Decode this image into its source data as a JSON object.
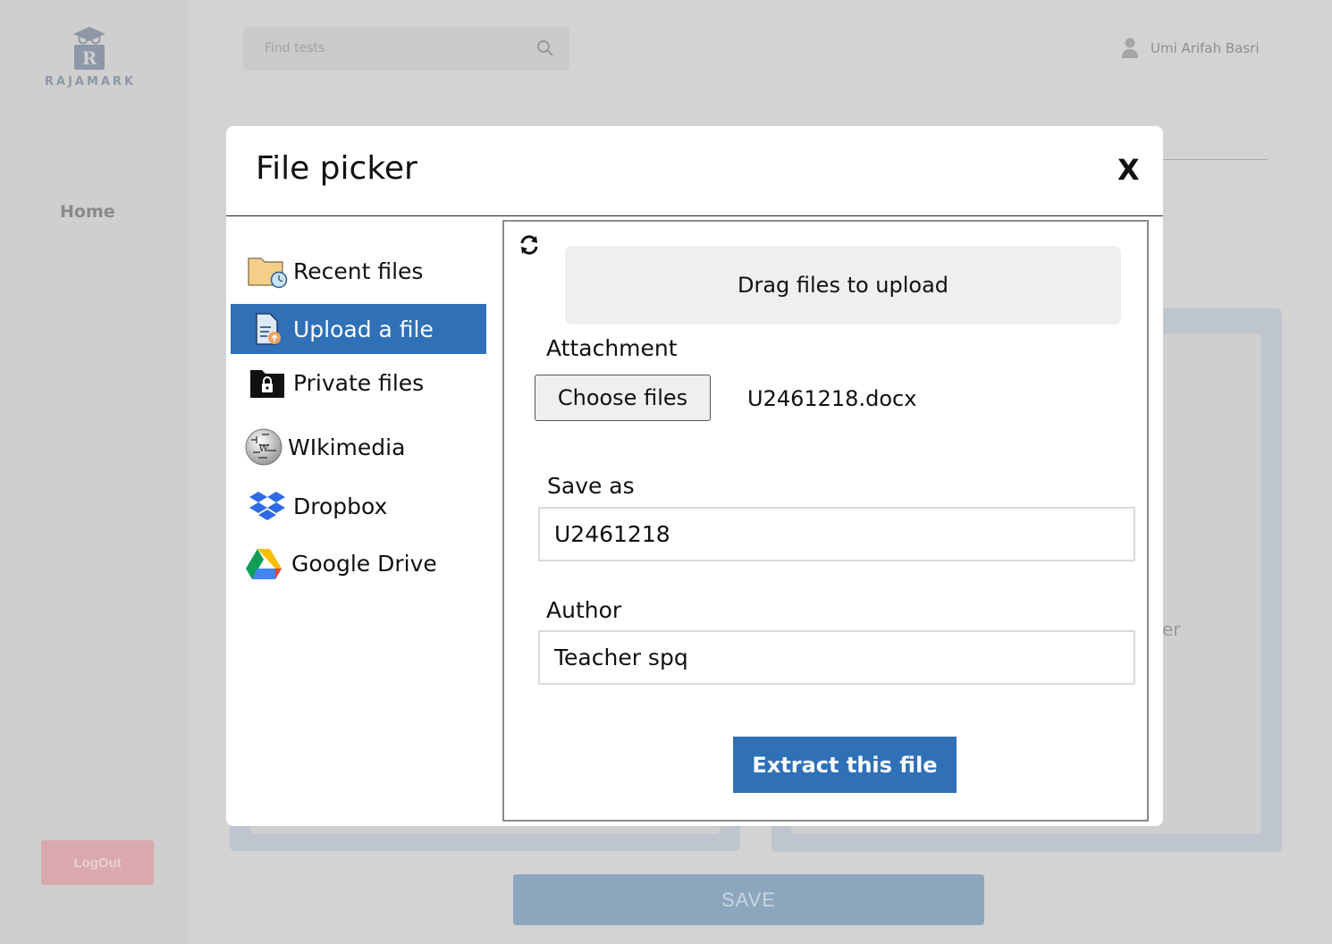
{
  "app": {
    "logo_text": "RAJAMARK",
    "nav_home": "Home",
    "logout_label": "LogOut",
    "search_placeholder": "Find tests",
    "user_name": "Umi Arifah Basri",
    "background_fragment": "er",
    "save_label": "SAVE"
  },
  "modal": {
    "title": "File picker",
    "close_label": "X",
    "repositories": [
      {
        "label": "Recent files",
        "icon": "clock-folder-icon",
        "active": false
      },
      {
        "label": "Upload a file",
        "icon": "upload-file-icon",
        "active": true
      },
      {
        "label": "Private files",
        "icon": "locked-folder-icon",
        "active": false
      },
      {
        "label": "WIkimedia",
        "icon": "wikipedia-globe-icon",
        "active": false
      },
      {
        "label": "Dropbox",
        "icon": "dropbox-icon",
        "active": false
      },
      {
        "label": "Google Drive",
        "icon": "google-drive-icon",
        "active": false
      }
    ],
    "upload": {
      "dropzone_text": "Drag files to upload",
      "attachment_label": "Attachment",
      "choose_files_label": "Choose files",
      "chosen_file": "U2461218.docx",
      "save_as_label": "Save as",
      "save_as_value": "U2461218",
      "author_label": "Author",
      "author_value": "Teacher spq",
      "submit_label": "Extract this file"
    }
  },
  "colors": {
    "accent": "#2f70b7",
    "overlay_bg": "#d3d3d3",
    "logout_bg": "#d9a9ad",
    "save_bg": "#8ca7bd"
  }
}
